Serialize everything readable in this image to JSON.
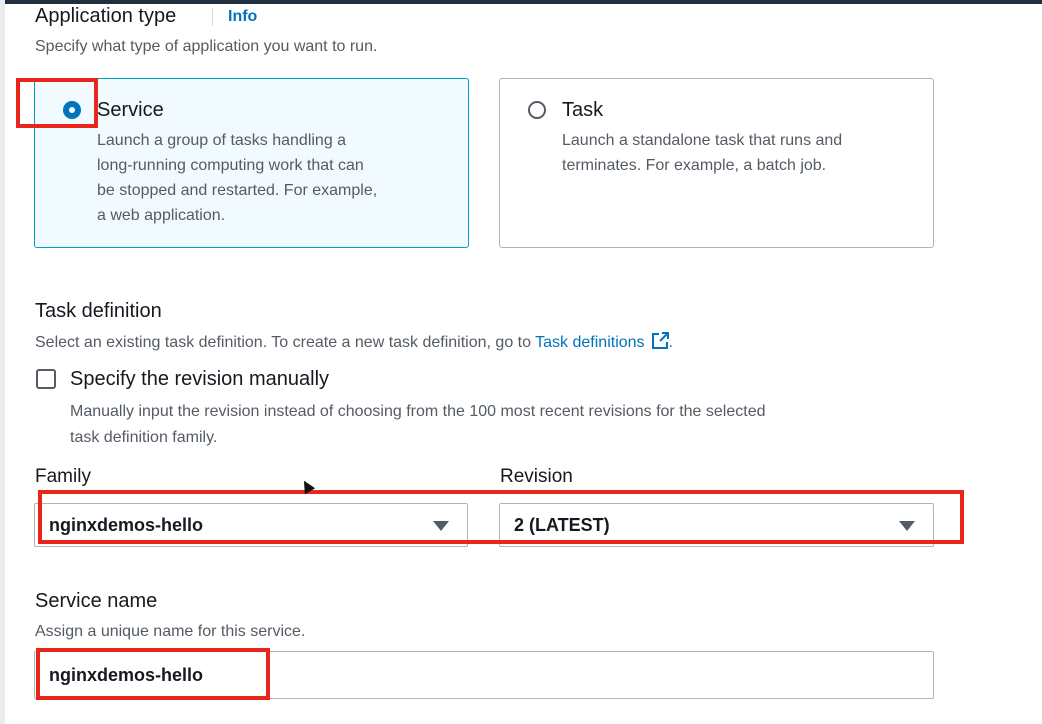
{
  "application_type": {
    "title": "Application type",
    "info_link": "Info",
    "description": "Specify what type of application you want to run.",
    "options": [
      {
        "label": "Service",
        "selected": true,
        "desc_lines": [
          "Launch a group of tasks handling a",
          "long-running computing work that can",
          "be stopped and restarted. For example,",
          "a web application."
        ]
      },
      {
        "label": "Task",
        "selected": false,
        "desc_lines": [
          "Launch a standalone task that runs and",
          "terminates. For example, a batch job."
        ]
      }
    ]
  },
  "task_definition": {
    "title": "Task definition",
    "description_prefix": "Select an existing task definition. To create a new task definition, go to",
    "link_text": "Task definitions",
    "description_suffix": ".",
    "manual_revision": {
      "label": "Specify the revision manually",
      "checked": false,
      "desc_lines": [
        "Manually input the revision instead of choosing from the 100 most recent revisions for the selected",
        "task definition family."
      ]
    },
    "family": {
      "label": "Family",
      "value": "nginxdemos-hello"
    },
    "revision": {
      "label": "Revision",
      "value": "2 (LATEST)"
    }
  },
  "service_name": {
    "title": "Service name",
    "description": "Assign a unique name for this service.",
    "value": "nginxdemos-hello"
  },
  "colors": {
    "accent": "#0073bb",
    "highlight": "#e8261c",
    "selected_card_bg": "#f1faff"
  },
  "icons": [
    "radio-selected-icon",
    "radio-unselected-icon",
    "external-link-icon",
    "dropdown-caret-icon",
    "checkbox-icon",
    "mouse-cursor-icon"
  ]
}
